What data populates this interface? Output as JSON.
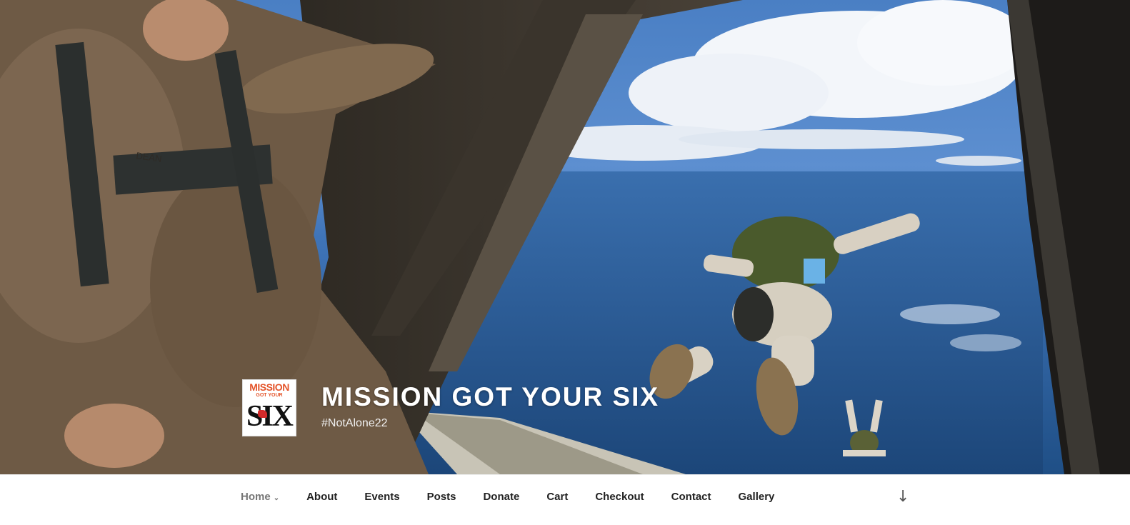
{
  "site": {
    "title": "MISSION GOT YOUR SIX",
    "description": "#NotAlone22",
    "logo": {
      "line1": "MISSION",
      "line2": "GOT YOUR",
      "line3": "SIX",
      "accent_color": "#e4542a"
    }
  },
  "hero": {
    "image_alt": "Paratroopers jumping from aircraft ramp over ocean",
    "image_label": "DEAN"
  },
  "nav": {
    "items": [
      {
        "label": "Home",
        "current": true,
        "has_submenu": true
      },
      {
        "label": "About"
      },
      {
        "label": "Events"
      },
      {
        "label": "Posts"
      },
      {
        "label": "Donate"
      },
      {
        "label": "Cart"
      },
      {
        "label": "Checkout"
      },
      {
        "label": "Contact"
      },
      {
        "label": "Gallery"
      }
    ],
    "submenu_icon": "chevron-down-icon",
    "scroll_icon": "arrow-down-icon",
    "scroll_glyph": "↓"
  }
}
